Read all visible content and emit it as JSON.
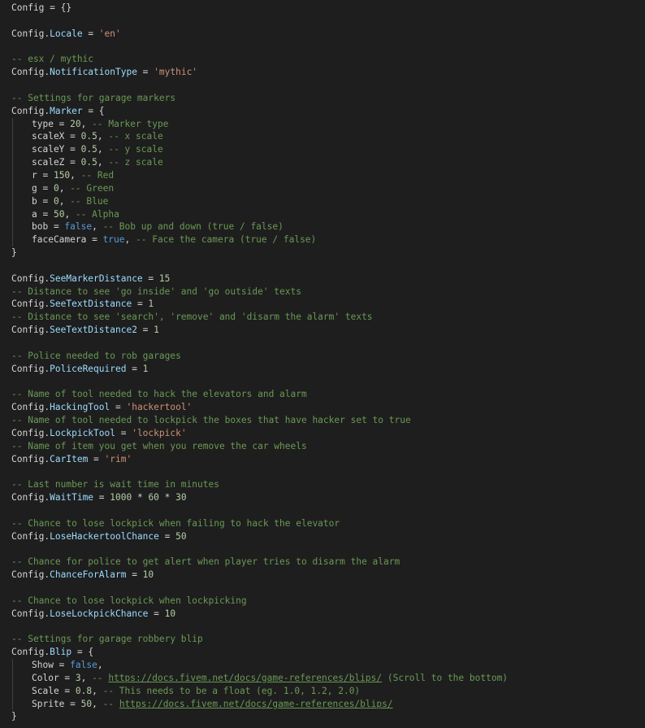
{
  "code": {
    "config_table": "Config",
    "lines": [
      {
        "id": "l1",
        "parts": [
          [
            "id",
            "Config"
          ],
          [
            "id",
            " = {}"
          ]
        ]
      },
      {
        "id": "l2",
        "parts": []
      },
      {
        "id": "l3",
        "parts": [
          [
            "id",
            "Config."
          ],
          [
            "pr",
            "Locale"
          ],
          [
            "id",
            " = "
          ],
          [
            "st",
            "'en'"
          ]
        ]
      },
      {
        "id": "l4",
        "parts": []
      },
      {
        "id": "l5",
        "parts": [
          [
            "cm",
            "-- esx / mythic"
          ]
        ]
      },
      {
        "id": "l6",
        "parts": [
          [
            "id",
            "Config."
          ],
          [
            "pr",
            "NotificationType"
          ],
          [
            "id",
            " = "
          ],
          [
            "st",
            "'mythic'"
          ]
        ]
      },
      {
        "id": "l7",
        "parts": []
      },
      {
        "id": "l8",
        "parts": [
          [
            "cm",
            "-- Settings for garage markers"
          ]
        ]
      },
      {
        "id": "l9",
        "parts": [
          [
            "id",
            "Config."
          ],
          [
            "pr",
            "Marker"
          ],
          [
            "id",
            " = {"
          ]
        ]
      },
      {
        "id": "l10",
        "indent": true,
        "parts": [
          [
            "id",
            "type = "
          ],
          [
            "nm",
            "20"
          ],
          [
            "id",
            ", "
          ],
          [
            "cm",
            "-- Marker type"
          ]
        ]
      },
      {
        "id": "l11",
        "indent": true,
        "parts": [
          [
            "id",
            "scaleX = "
          ],
          [
            "nm",
            "0.5"
          ],
          [
            "id",
            ", "
          ],
          [
            "cm",
            "-- x scale"
          ]
        ]
      },
      {
        "id": "l12",
        "indent": true,
        "parts": [
          [
            "id",
            "scaleY = "
          ],
          [
            "nm",
            "0.5"
          ],
          [
            "id",
            ", "
          ],
          [
            "cm",
            "-- y scale"
          ]
        ]
      },
      {
        "id": "l13",
        "indent": true,
        "parts": [
          [
            "id",
            "scaleZ = "
          ],
          [
            "nm",
            "0.5"
          ],
          [
            "id",
            ", "
          ],
          [
            "cm",
            "-- z scale"
          ]
        ]
      },
      {
        "id": "l14",
        "indent": true,
        "parts": [
          [
            "id",
            "r = "
          ],
          [
            "nm",
            "150"
          ],
          [
            "id",
            ", "
          ],
          [
            "cm",
            "-- Red"
          ]
        ]
      },
      {
        "id": "l15",
        "indent": true,
        "parts": [
          [
            "id",
            "g = "
          ],
          [
            "nm",
            "0"
          ],
          [
            "id",
            ", "
          ],
          [
            "cm",
            "-- Green"
          ]
        ]
      },
      {
        "id": "l16",
        "indent": true,
        "parts": [
          [
            "id",
            "b = "
          ],
          [
            "nm",
            "0"
          ],
          [
            "id",
            ", "
          ],
          [
            "cm",
            "-- Blue"
          ]
        ]
      },
      {
        "id": "l17",
        "indent": true,
        "parts": [
          [
            "id",
            "a = "
          ],
          [
            "nm",
            "50"
          ],
          [
            "id",
            ", "
          ],
          [
            "cm",
            "-- Alpha"
          ]
        ]
      },
      {
        "id": "l18",
        "indent": true,
        "parts": [
          [
            "id",
            "bob = "
          ],
          [
            "kw",
            "false"
          ],
          [
            "id",
            ", "
          ],
          [
            "cm",
            "-- Bob up and down (true / false)"
          ]
        ]
      },
      {
        "id": "l19",
        "indent": true,
        "parts": [
          [
            "id",
            "faceCamera = "
          ],
          [
            "kw",
            "true"
          ],
          [
            "id",
            ", "
          ],
          [
            "cm",
            "-- Face the camera (true / false)"
          ]
        ]
      },
      {
        "id": "l20",
        "parts": [
          [
            "id",
            "}"
          ]
        ]
      },
      {
        "id": "l21",
        "parts": []
      },
      {
        "id": "l22",
        "parts": [
          [
            "id",
            "Config."
          ],
          [
            "pr",
            "SeeMarkerDistance"
          ],
          [
            "id",
            " = "
          ],
          [
            "nm",
            "15"
          ]
        ]
      },
      {
        "id": "l23",
        "parts": [
          [
            "cm",
            "-- Distance to see 'go inside' and 'go outside' texts"
          ]
        ]
      },
      {
        "id": "l24",
        "parts": [
          [
            "id",
            "Config."
          ],
          [
            "pr",
            "SeeTextDistance"
          ],
          [
            "id",
            " = "
          ],
          [
            "nm",
            "1"
          ]
        ]
      },
      {
        "id": "l25",
        "parts": [
          [
            "cm",
            "-- Distance to see 'search', 'remove' and 'disarm the alarm' texts"
          ]
        ]
      },
      {
        "id": "l26",
        "parts": [
          [
            "id",
            "Config."
          ],
          [
            "pr",
            "SeeTextDistance2"
          ],
          [
            "id",
            " = "
          ],
          [
            "nm",
            "1"
          ]
        ]
      },
      {
        "id": "l27",
        "parts": []
      },
      {
        "id": "l28",
        "parts": [
          [
            "cm",
            "-- Police needed to rob garages"
          ]
        ]
      },
      {
        "id": "l29",
        "parts": [
          [
            "id",
            "Config."
          ],
          [
            "pr",
            "PoliceRequired"
          ],
          [
            "id",
            " = "
          ],
          [
            "nm",
            "1"
          ]
        ]
      },
      {
        "id": "l30",
        "parts": []
      },
      {
        "id": "l31",
        "parts": [
          [
            "cm",
            "-- Name of tool needed to hack the elevators and alarm"
          ]
        ]
      },
      {
        "id": "l32",
        "parts": [
          [
            "id",
            "Config."
          ],
          [
            "pr",
            "HackingTool"
          ],
          [
            "id",
            " = "
          ],
          [
            "st",
            "'hackertool'"
          ]
        ]
      },
      {
        "id": "l33",
        "parts": [
          [
            "cm",
            "-- Name of tool needed to lockpick the boxes that have hacker set to true"
          ]
        ]
      },
      {
        "id": "l34",
        "parts": [
          [
            "id",
            "Config."
          ],
          [
            "pr",
            "LockpickTool"
          ],
          [
            "id",
            " = "
          ],
          [
            "st",
            "'lockpick'"
          ]
        ]
      },
      {
        "id": "l35",
        "parts": [
          [
            "cm",
            "-- Name of item you get when you remove the car wheels"
          ]
        ]
      },
      {
        "id": "l36",
        "parts": [
          [
            "id",
            "Config."
          ],
          [
            "pr",
            "CarItem"
          ],
          [
            "id",
            " = "
          ],
          [
            "st",
            "'rim'"
          ]
        ]
      },
      {
        "id": "l37",
        "parts": []
      },
      {
        "id": "l38",
        "parts": [
          [
            "cm",
            "-- Last number is wait time in minutes"
          ]
        ]
      },
      {
        "id": "l39",
        "parts": [
          [
            "id",
            "Config."
          ],
          [
            "pr",
            "WaitTime"
          ],
          [
            "id",
            " = "
          ],
          [
            "nm",
            "1000"
          ],
          [
            "id",
            " * "
          ],
          [
            "nm",
            "60"
          ],
          [
            "id",
            " * "
          ],
          [
            "nm",
            "30"
          ]
        ]
      },
      {
        "id": "l40",
        "parts": []
      },
      {
        "id": "l41",
        "parts": [
          [
            "cm",
            "-- Chance to lose lockpick when failing to hack the elevator"
          ]
        ]
      },
      {
        "id": "l42",
        "parts": [
          [
            "id",
            "Config."
          ],
          [
            "pr",
            "LoseHackertoolChance"
          ],
          [
            "id",
            " = "
          ],
          [
            "nm",
            "50"
          ]
        ]
      },
      {
        "id": "l43",
        "parts": []
      },
      {
        "id": "l44",
        "parts": [
          [
            "cm",
            "-- Chance for police to get alert when player tries to disarm the alarm"
          ]
        ]
      },
      {
        "id": "l45",
        "parts": [
          [
            "id",
            "Config."
          ],
          [
            "pr",
            "ChanceForAlarm"
          ],
          [
            "id",
            " = "
          ],
          [
            "nm",
            "10"
          ]
        ]
      },
      {
        "id": "l46",
        "parts": []
      },
      {
        "id": "l47",
        "parts": [
          [
            "cm",
            "-- Chance to lose lockpick when lockpicking"
          ]
        ]
      },
      {
        "id": "l48",
        "parts": [
          [
            "id",
            "Config."
          ],
          [
            "pr",
            "LoseLockpickChance"
          ],
          [
            "id",
            " = "
          ],
          [
            "nm",
            "10"
          ]
        ]
      },
      {
        "id": "l49",
        "parts": []
      },
      {
        "id": "l50",
        "parts": [
          [
            "cm",
            "-- Settings for garage robbery blip"
          ]
        ]
      },
      {
        "id": "l51",
        "parts": [
          [
            "id",
            "Config."
          ],
          [
            "pr",
            "Blip"
          ],
          [
            "id",
            " = {"
          ]
        ]
      },
      {
        "id": "l52",
        "indent": true,
        "parts": [
          [
            "id",
            "Show = "
          ],
          [
            "kw",
            "false"
          ],
          [
            "id",
            ","
          ]
        ]
      },
      {
        "id": "l53",
        "indent": true,
        "parts": [
          [
            "id",
            "Color = "
          ],
          [
            "nm",
            "3"
          ],
          [
            "id",
            ", "
          ],
          [
            "cm",
            "-- "
          ],
          [
            "url",
            "https://docs.fivem.net/docs/game-references/blips/"
          ],
          [
            "cm",
            " (Scroll to the bottom)"
          ]
        ]
      },
      {
        "id": "l54",
        "indent": true,
        "parts": [
          [
            "id",
            "Scale = "
          ],
          [
            "nm",
            "0.8"
          ],
          [
            "id",
            ", "
          ],
          [
            "cm",
            "-- This needs to be a float (eg. 1.0, 1.2, 2.0)"
          ]
        ]
      },
      {
        "id": "l55",
        "indent": true,
        "parts": [
          [
            "id",
            "Sprite = "
          ],
          [
            "nm",
            "50"
          ],
          [
            "id",
            ", "
          ],
          [
            "cm",
            "-- "
          ],
          [
            "url",
            "https://docs.fivem.net/docs/game-references/blips/"
          ]
        ]
      },
      {
        "id": "l56",
        "parts": [
          [
            "id",
            "}"
          ]
        ]
      }
    ]
  }
}
